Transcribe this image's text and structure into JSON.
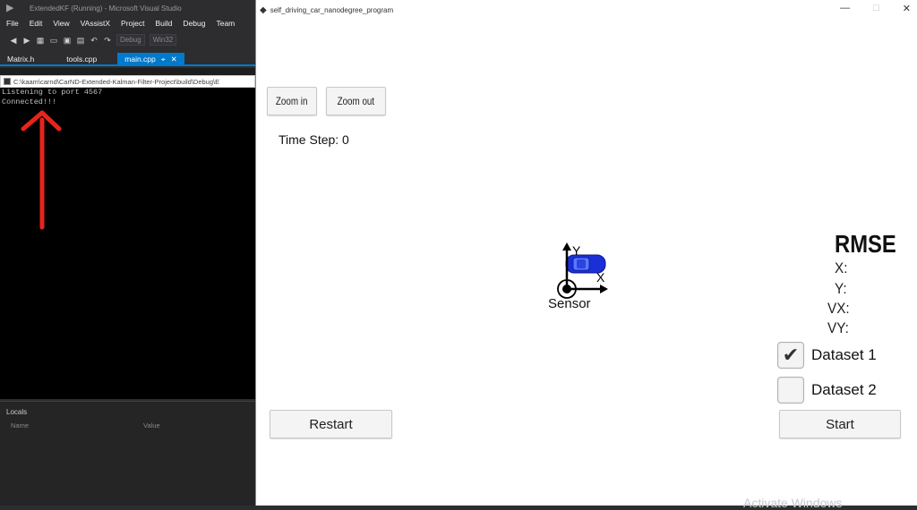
{
  "vs": {
    "title": "ExtendedKF (Running) - Microsoft Visual Studio",
    "menu": [
      "File",
      "Edit",
      "View",
      "VAssistX",
      "Project",
      "Build",
      "Debug",
      "Team"
    ],
    "toolbar": {
      "config": "Debug",
      "platform": "Win32"
    },
    "tabs": [
      {
        "label": "Matrix.h"
      },
      {
        "label": "tools.cpp"
      },
      {
        "label": "main.cpp",
        "active": true
      }
    ],
    "console": {
      "path": "C:\\kaam\\carnd\\CarND-Extended-Kalman-Filter-Project\\build\\Debug\\E",
      "lines": [
        "Listening to port 4567",
        "Connected!!!"
      ]
    },
    "locals": {
      "title": "Locals",
      "col_name": "Name",
      "col_value": "Value"
    }
  },
  "sim": {
    "title": "self_driving_car_nanodegree_program",
    "zoom_in": "Zoom in",
    "zoom_out": "Zoom out",
    "time_step": "Time Step: 0",
    "sensor_label": "Sensor",
    "axis_y": "Y",
    "axis_x": "X",
    "rmse": {
      "title": "RMSE",
      "x": "X:",
      "y": "Y:",
      "vx": "VX:",
      "vy": "VY:"
    },
    "datasets": [
      {
        "label": "Dataset 1",
        "checked": true
      },
      {
        "label": "Dataset 2",
        "checked": false
      }
    ],
    "restart": "Restart",
    "start": "Start",
    "watermark": "Activate Windows"
  },
  "colors": {
    "vs_accent": "#007acc",
    "annotation_arrow": "#e8241b",
    "car_blue": "#1a2fd6"
  }
}
